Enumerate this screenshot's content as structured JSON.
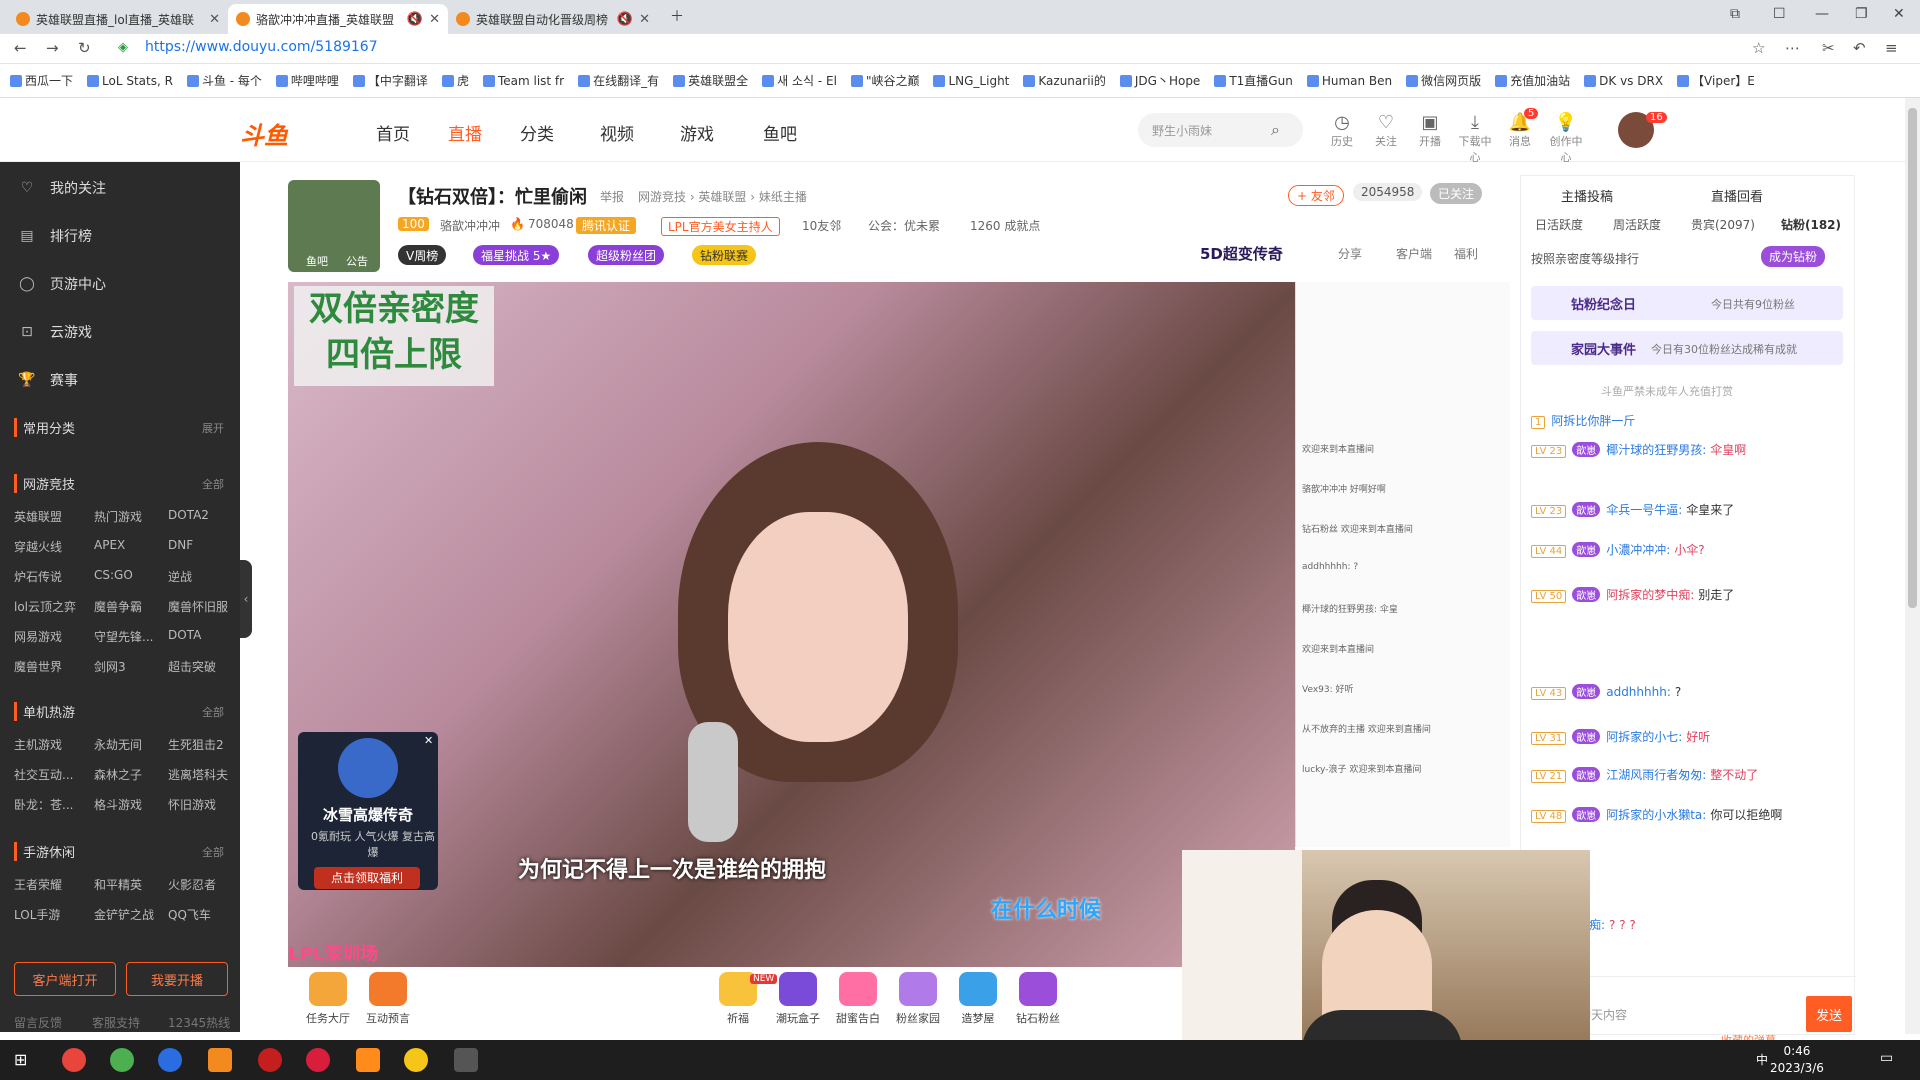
{
  "browser": {
    "tabs": [
      {
        "title": "英雄联盟直播_lol直播_英雄联"
      },
      {
        "title": "骆歆冲冲冲直播_英雄联盟"
      },
      {
        "title": "英雄联盟自动化晋级周榜"
      }
    ],
    "url": "https://www.douyu.com/5189167",
    "bookmarks": [
      "西瓜一下",
      "LoL Stats, R",
      "斗鱼 - 每个",
      "哔哩哔哩",
      "【中字翻译",
      "虎",
      "Team list fr",
      "在线翻译_有",
      "英雄联盟全",
      "새 소식 - El",
      "\"峡谷之巅",
      "LNG_Light",
      "Kazunarii的",
      "JDG丶Hope",
      "T1直播Gun",
      "Human Ben",
      "微信网页版",
      "充值加油站",
      "DK vs DRX",
      "【Viper】E"
    ]
  },
  "header": {
    "logo": "斗鱼",
    "nav": [
      "首页",
      "直播",
      "分类",
      "视频",
      "游戏",
      "鱼吧"
    ],
    "active_nav": "直播",
    "search_placeholder": "野生小雨妹",
    "icons": [
      "历史",
      "关注",
      "开播",
      "下载中心",
      "消息",
      "创作中心"
    ],
    "message_count": "5",
    "avatar_count": "16"
  },
  "sidebar": {
    "main": [
      "我的关注",
      "排行榜",
      "页游中心",
      "云游戏",
      "赛事"
    ],
    "common_label": "常用分类",
    "expand": "展开",
    "sections": [
      {
        "title": "网游竞技",
        "more": "全部",
        "items": [
          "英雄联盟",
          "热门游戏",
          "DOTA2",
          "穿越火线",
          "APEX",
          "DNF",
          "炉石传说",
          "CS:GO",
          "逆战",
          "lol云顶之弈",
          "魔兽争霸",
          "魔兽怀旧服",
          "网易游戏",
          "守望先锋...",
          "DOTA",
          "魔兽世界",
          "剑网3",
          "超击突破"
        ]
      },
      {
        "title": "单机热游",
        "more": "全部",
        "items": [
          "主机游戏",
          "永劫无间",
          "生死狙击2",
          "社交互动...",
          "森林之子",
          "逃离塔科夫",
          "卧龙：苍...",
          "格斗游戏",
          "怀旧游戏"
        ]
      },
      {
        "title": "手游休闲",
        "more": "全部",
        "items": [
          "王者荣耀",
          "和平精英",
          "火影忍者",
          "LOL手游",
          "金铲铲之战",
          "QQ飞车"
        ]
      }
    ],
    "btn_client": "客户端打开",
    "btn_stream": "我要开播",
    "footer": [
      "留言反馈",
      "客服支持",
      "12345热线"
    ]
  },
  "room": {
    "title": "【钻石双倍】：忙里偷闲",
    "report": "举报",
    "category": "网游竞技 › 英雄联盟 › 妹纸主播",
    "level": "100",
    "streamer": "骆歆冲冲冲",
    "heat": "708048",
    "cert": "腾讯认证",
    "tag": "LPL官方美女主持人",
    "friends": "10友邻",
    "guild": "公会：优未累",
    "achievements": "1260 成就点",
    "follow_btn": "+ 友邻",
    "follower_count": "2054958",
    "followed": "已关注",
    "pills": [
      "V周榜",
      "福星挑战 5★",
      "超级粉丝团",
      "钻粉联赛"
    ],
    "brand": "5D超变传奇",
    "actions": [
      "分享",
      "客户端",
      "福利"
    ],
    "avatar_labels": [
      "鱼吧",
      "公告"
    ]
  },
  "video": {
    "promo": "双倍亲密度 四倍上限",
    "subtitle1": "为何记不得上一次是谁给的拥抱",
    "subtitle2": "在什么时候",
    "watermark": "LPL深圳场",
    "ad_title": "冰雪高爆传奇",
    "ad_tags": "0氪耐玩  人气火爆  复古高爆",
    "ad_cta": "点击领取福利",
    "overlay_chat": [
      "欢迎来到本直播间",
      "骆歆冲冲冲 好啊好啊",
      "钻石粉丝 欢迎来到本直播间",
      "addhhhhh: ?",
      "椰汁球的狂野男孩: 伞皇",
      "欢迎来到本直播间",
      "Vex93: 好听",
      "从不放弃的主播 欢迎来到直播间",
      "lucky-浪子 欢迎来到本直播间"
    ]
  },
  "toolbar": [
    "任务大厅",
    "互动预言",
    "祈福",
    "潮玩盒子",
    "甜蜜告白",
    "粉丝家园",
    "造梦屋",
    "钻石粉丝"
  ],
  "toolbar_new": "NEW",
  "chat": {
    "tabs_top": [
      "主播投稿",
      "直播回看"
    ],
    "tabs": [
      "日活跃度",
      "周活跃度",
      "贵宾(2097)",
      "钻粉(182)"
    ],
    "rank_text": "按照亲密度等级排行",
    "join_btn": "成为钻粉",
    "banner1": "钻粉纪念日",
    "banner1_note": "今日共有9位粉丝",
    "banner2": "家园大事件",
    "banner2_note": "今日有30位粉丝达成稀有成就",
    "notice": "斗鱼严禁未成年人充值打赏",
    "messages": [
      {
        "lv": "1",
        "user": "阿拆比你胖一斤",
        "text": ""
      },
      {
        "lv": "LV 23",
        "user": "椰汁球的狂野男孩:",
        "text": "伞皇啊"
      },
      {
        "lv": "LV 23",
        "user": "伞兵一号牛逼:",
        "text": "伞皇来了"
      },
      {
        "lv": "LV 44",
        "user": "小濃冲冲冲:",
        "text": "小伞?"
      },
      {
        "lv": "LV 50",
        "user": "阿拆家的梦中痴:",
        "text": "别走了"
      },
      {
        "lv": "LV 43",
        "user": "addhhhhh:",
        "text": "?"
      },
      {
        "lv": "LV 31",
        "user": "阿拆家的小七:",
        "text": "好听"
      },
      {
        "lv": "LV 21",
        "user": "江湖风雨行者匆匆:",
        "text": "整不动了"
      },
      {
        "lv": "LV 48",
        "user": "阿拆家的小水獭ta:",
        "text": "你可以拒绝啊"
      },
      {
        "lv": "",
        "user": "梦中痴:",
        "text": "? ? ?"
      }
    ],
    "badge": "歆崽",
    "input_placeholder": "这里输入聊天内容",
    "send": "发送",
    "emote_hint": "收藏的弹幕"
  },
  "taskbar": {
    "time": "0:46",
    "date": "2023/3/6",
    "ime": "中"
  }
}
